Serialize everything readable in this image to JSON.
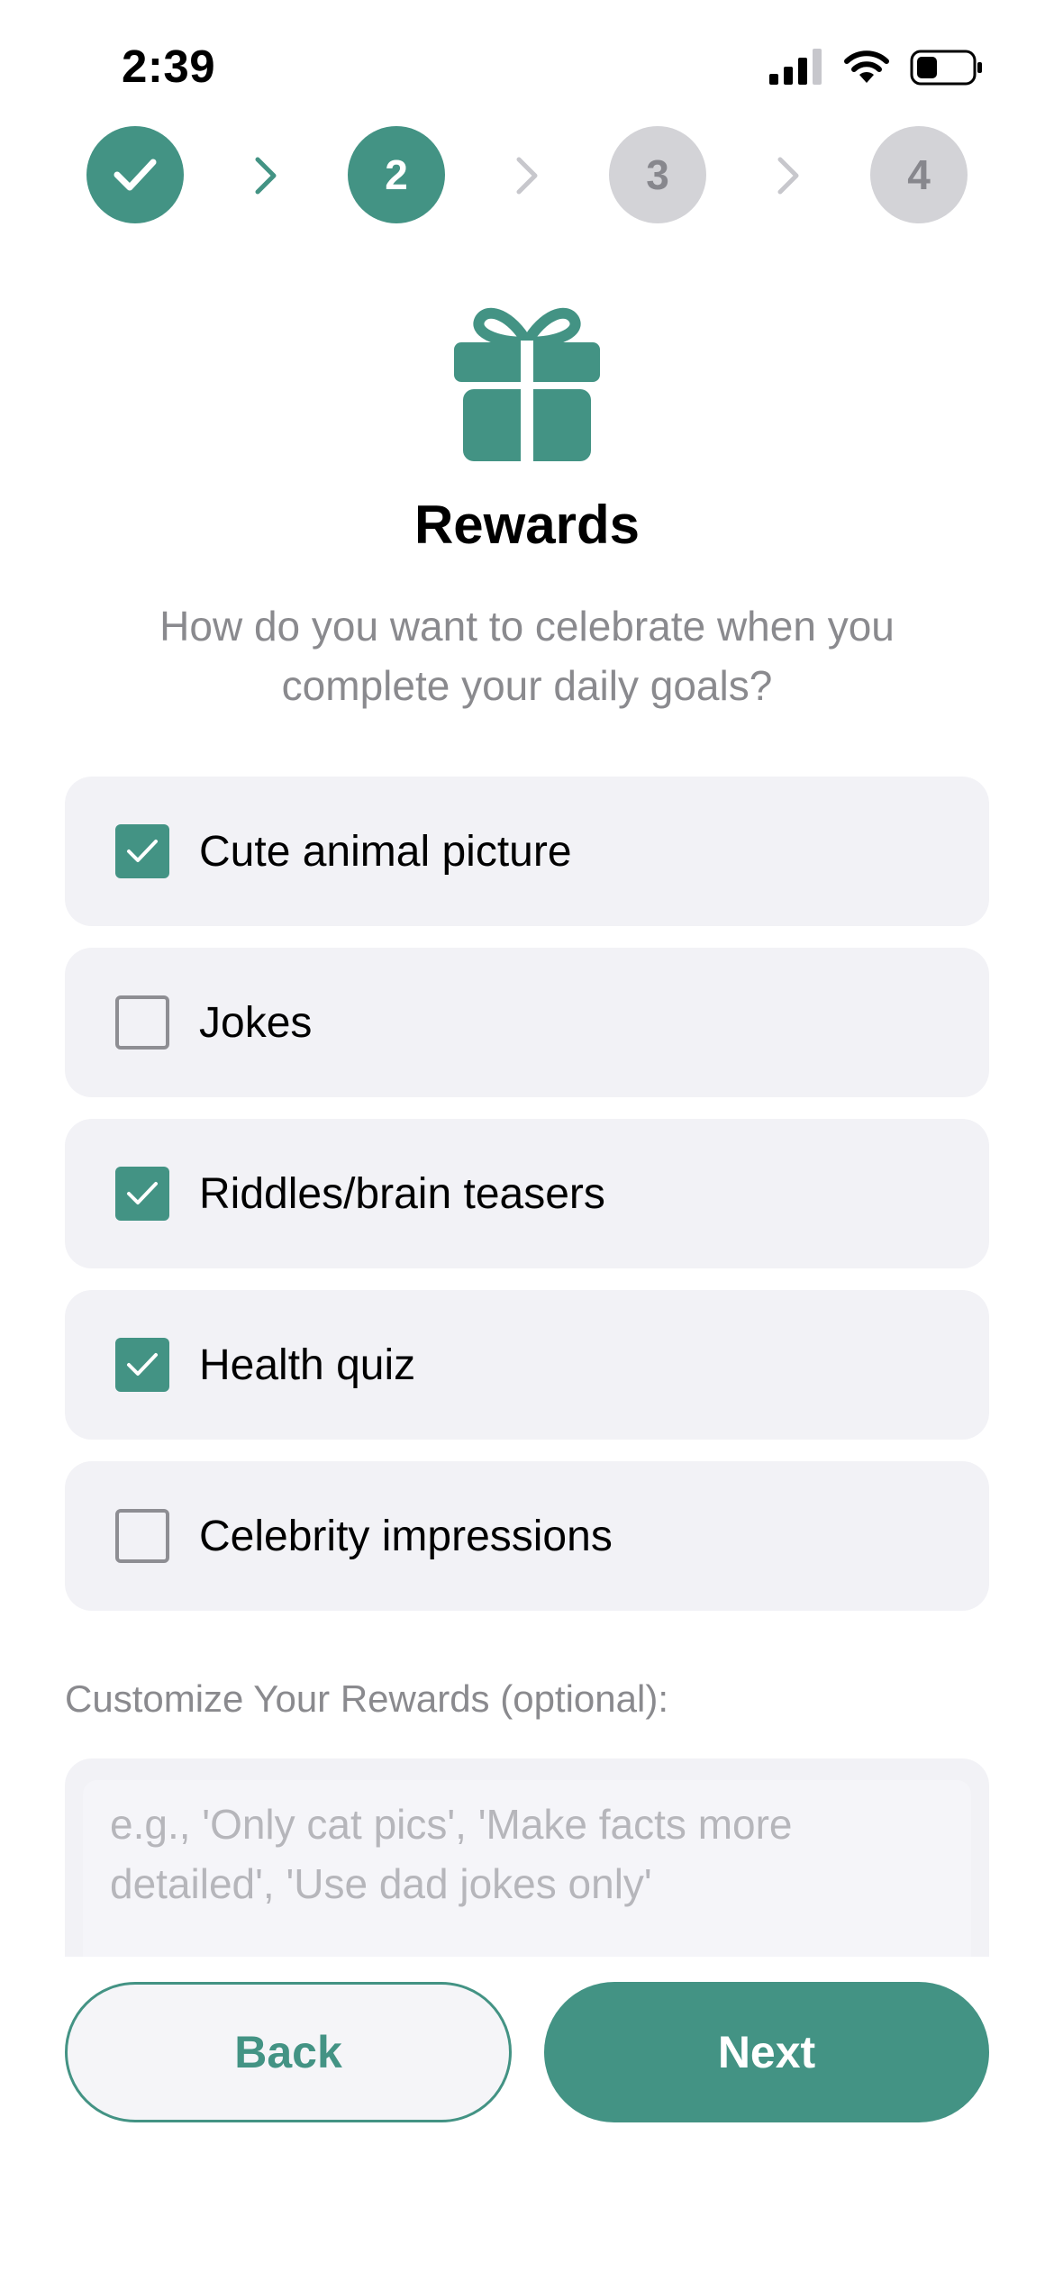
{
  "status_bar": {
    "time": "2:39",
    "signal_icon": "cellular-signal-icon",
    "wifi_icon": "wifi-icon",
    "battery_icon": "battery-icon"
  },
  "stepper": {
    "steps": [
      {
        "label": "",
        "state": "done",
        "icon": "checkmark-icon"
      },
      {
        "label": "2",
        "state": "active"
      },
      {
        "label": "3",
        "state": "pending"
      },
      {
        "label": "4",
        "state": "pending"
      }
    ],
    "separator_icon": "chevron-right-icon"
  },
  "header": {
    "icon": "gift-icon",
    "title": "Rewards",
    "subtitle": "How do you want to celebrate when you complete your daily goals?"
  },
  "options": [
    {
      "label": "Cute animal picture",
      "checked": true
    },
    {
      "label": "Jokes",
      "checked": false
    },
    {
      "label": "Riddles/brain teasers",
      "checked": true
    },
    {
      "label": "Health quiz",
      "checked": true
    },
    {
      "label": "Celebrity impressions",
      "checked": false
    }
  ],
  "customize": {
    "label": "Customize Your Rewards (optional):",
    "value": "",
    "placeholder": "e.g., 'Only cat pics', 'Make facts more detailed', 'Use dad jokes only'"
  },
  "buttons": {
    "back": "Back",
    "next": "Next"
  },
  "colors": {
    "accent": "#439384",
    "pending_step": "#d3d3d7",
    "card_background": "#f2f2f6",
    "secondary_text": "#8a8a8e"
  }
}
